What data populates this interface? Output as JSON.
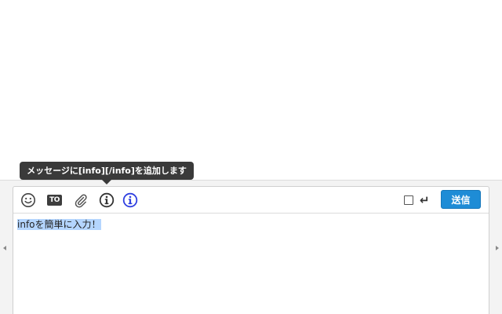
{
  "tooltip": {
    "text": "メッセージに[info][/info]を追加します"
  },
  "toolbar": {
    "icons": [
      {
        "name": "emoji-icon"
      },
      {
        "name": "to-icon",
        "label": "TO"
      },
      {
        "name": "attach-icon"
      },
      {
        "name": "info-icon"
      },
      {
        "name": "info-tag-icon"
      }
    ],
    "to_label": "TO",
    "enter_icon": "↵",
    "send_label": "送信",
    "colors": {
      "send_button": "#1e8cd6",
      "info_tag_icon": "#2f3fe0",
      "icon_default": "#444444"
    }
  },
  "message": {
    "value": "infoを簡単に入力！",
    "selected": true
  }
}
